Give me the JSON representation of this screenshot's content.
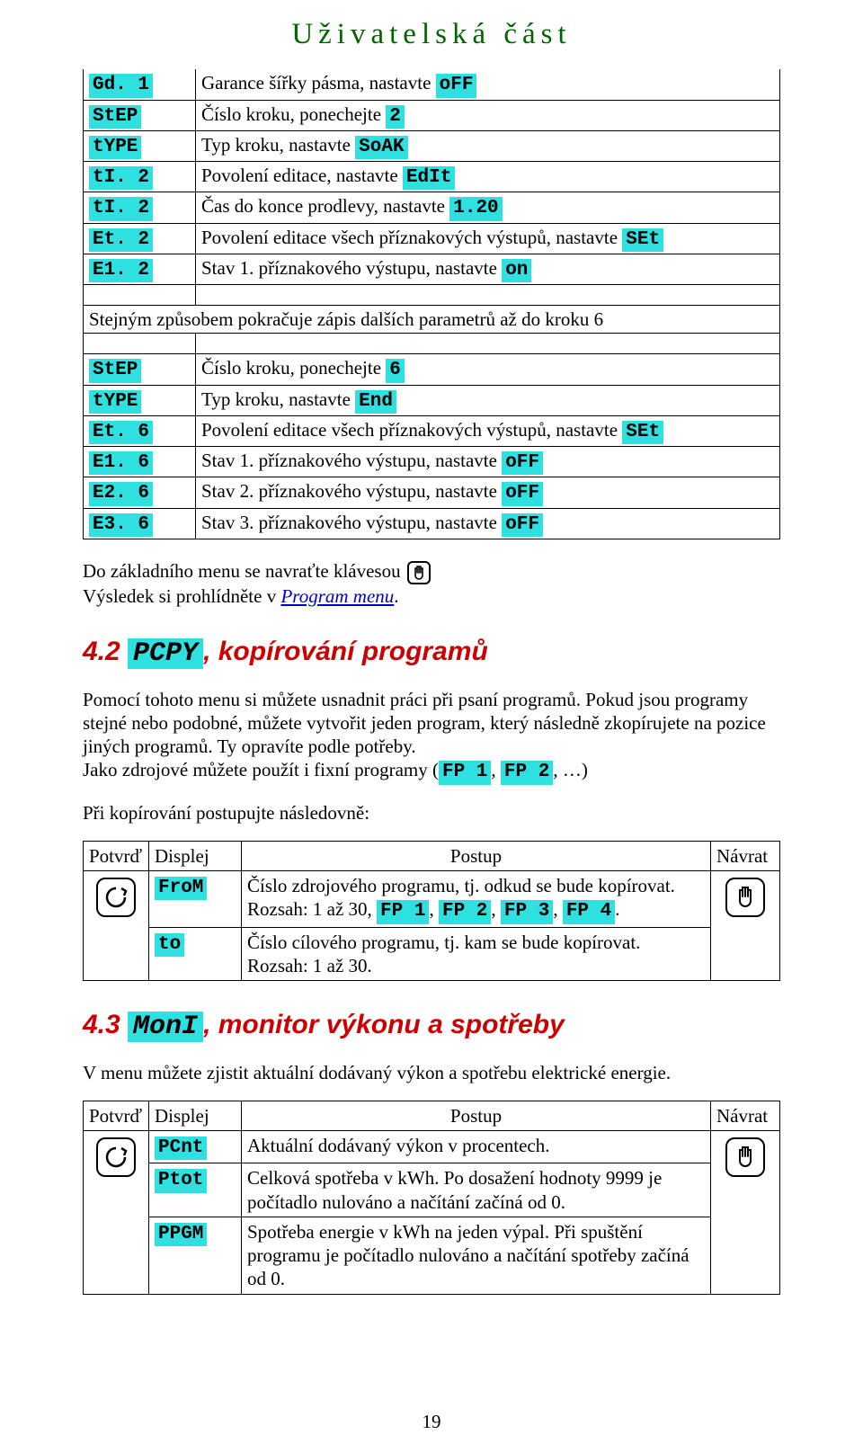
{
  "header": "Uživatelská část",
  "table1": {
    "rows": [
      {
        "c1_code": "Gd. 1",
        "c2_pre": "Garance šířky pásma, nastavte ",
        "c2_hl": " oFF"
      },
      {
        "c1_code": "StEP",
        "c2_pre": "Číslo kroku, ponechejte ",
        "c2_hl": "   2"
      },
      {
        "c1_code": "tYPE",
        "c2_pre": "Typ kroku, nastavte ",
        "c2_hlkw": "SoAK"
      },
      {
        "c1_code": "tI. 2",
        "c2_pre": "Povolení editace, nastavte ",
        "c2_hlkw": "EdIt"
      },
      {
        "c1_code": "tI. 2",
        "c2_pre": "Čas do konce prodlevy, nastavte ",
        "c2_hlkw": "1.20"
      },
      {
        "c1_code": "Et. 2",
        "c2_pre": "Povolení editace všech příznakových výstupů, nastavte ",
        "c2_hl": " SEt"
      },
      {
        "c1_code": "E1. 2",
        "c2_pre": "Stav 1. příznakového výstupu, nastavte ",
        "c2_hl": "  on"
      }
    ],
    "note": "Stejným způsobem pokračuje zápis dalších parametrů až do kroku 6",
    "rows2": [
      {
        "c1_code": "StEP",
        "c2_pre": "Číslo kroku, ponechejte ",
        "c2_hl": "   6"
      },
      {
        "c1_code": "tYPE",
        "c2_pre": "Typ kroku, nastavte ",
        "c2_hlkw": " End"
      },
      {
        "c1_code": "Et. 6",
        "c2_pre": "Povolení editace všech příznakových výstupů, nastavte ",
        "c2_hl": " SEt"
      },
      {
        "c1_code": "E1. 6",
        "c2_pre": "Stav 1. příznakového výstupu, nastavte ",
        "c2_hl": " oFF"
      },
      {
        "c1_code": "E2. 6",
        "c2_pre": "Stav 2. příznakového výstupu, nastavte ",
        "c2_hl": " oFF"
      },
      {
        "c1_code": "E3. 6",
        "c2_pre": "Stav 3. příznakového výstupu, nastavte ",
        "c2_hl": " oFF"
      }
    ]
  },
  "after_table": {
    "line1_pre": "Do základního menu se navraťte klávesou ",
    "line2_pre": "Výsledek si prohlídněte v ",
    "line2_link": "Program menu",
    "line2_post": "."
  },
  "section_42": {
    "num": "4.2 ",
    "kw": "PCPY",
    "title": ", kopírování programů",
    "para1a": "Pomocí tohoto menu si můžete usnadnit práci při psaní programů. Pokud jsou programy stejné nebo podobné, můžete vytvořit jeden program, který následně zkopírujete na pozice jiných programů. Ty opravíte podle potřeby.",
    "para1b_pre": "Jako zdrojové můžete použít i fixní programy (",
    "fp1": "FP 1",
    "sep1": ", ",
    "fp2": "FP 2",
    "para1b_post": ", …)",
    "para2": "Při kopírování postupujte následovně:",
    "table": {
      "h1": "Potvrď",
      "h2": "Displej",
      "h3": "Postup",
      "h4": "Návrat",
      "row1_kw": "FroM",
      "row1_line1": "Číslo zdrojového programu, tj. odkud se bude kopírovat.",
      "row1_line2_pre": "Rozsah: 1 až 30, ",
      "row1_fp1": "FP 1",
      "row1_s1": ", ",
      "row1_fp2": "FP 2",
      "row1_s2": ", ",
      "row1_fp3": "FP 3",
      "row1_s3": ", ",
      "row1_fp4": "FP 4",
      "row1_s4": ".",
      "row2_kw": "to",
      "row2_line1": "Číslo cílového programu, tj. kam se bude kopírovat.",
      "row2_line2": "Rozsah: 1 až 30."
    }
  },
  "section_43": {
    "num": "4.3 ",
    "kw": "MonI",
    "title": ", monitor výkonu a spotřeby",
    "para": "V menu můžete zjistit aktuální dodávaný výkon a spotřebu elektrické energie.",
    "table": {
      "h1": "Potvrď",
      "h2": "Displej",
      "h3": "Postup",
      "h4": "Návrat",
      "row1_kw": "PCnt",
      "row1": "Aktuální dodávaný výkon v procentech.",
      "row2_kw": "Ptot",
      "row2": "Celková spotřeba v kWh. Po dosažení hodnoty 9999 je počítadlo nulováno a načítání začíná od 0.",
      "row3_kw": "PPGM",
      "row3": "Spotřeba energie v kWh na jeden výpal. Při spuštění programu je počítadlo nulováno a načítání spotřeby začíná od 0."
    }
  },
  "page_number": "19"
}
